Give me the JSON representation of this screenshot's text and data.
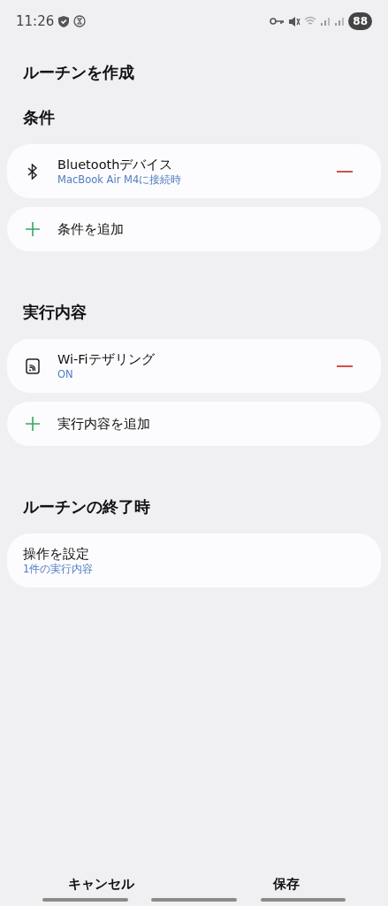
{
  "status_bar": {
    "time": "11:26",
    "battery": "88"
  },
  "title": "ルーチンを作成",
  "sections": [
    {
      "title": "条件",
      "items": [
        {
          "kind": "bluetooth",
          "title": "Bluetoothデバイス",
          "subtitle": "MacBook Air M4に接続時"
        },
        {
          "kind": "add",
          "title": "条件を追加"
        }
      ]
    },
    {
      "title": "実行内容",
      "items": [
        {
          "kind": "hotspot",
          "title": "Wi-Fiテザリング",
          "subtitle": "ON"
        },
        {
          "kind": "add",
          "title": "実行内容を追加"
        }
      ]
    },
    {
      "title": "ルーチンの終了時",
      "items": [
        {
          "kind": "setting",
          "title": "操作を設定",
          "subtitle": "1件の実行内容"
        }
      ]
    }
  ],
  "buttons": [
    "キャンセル",
    "保存"
  ]
}
